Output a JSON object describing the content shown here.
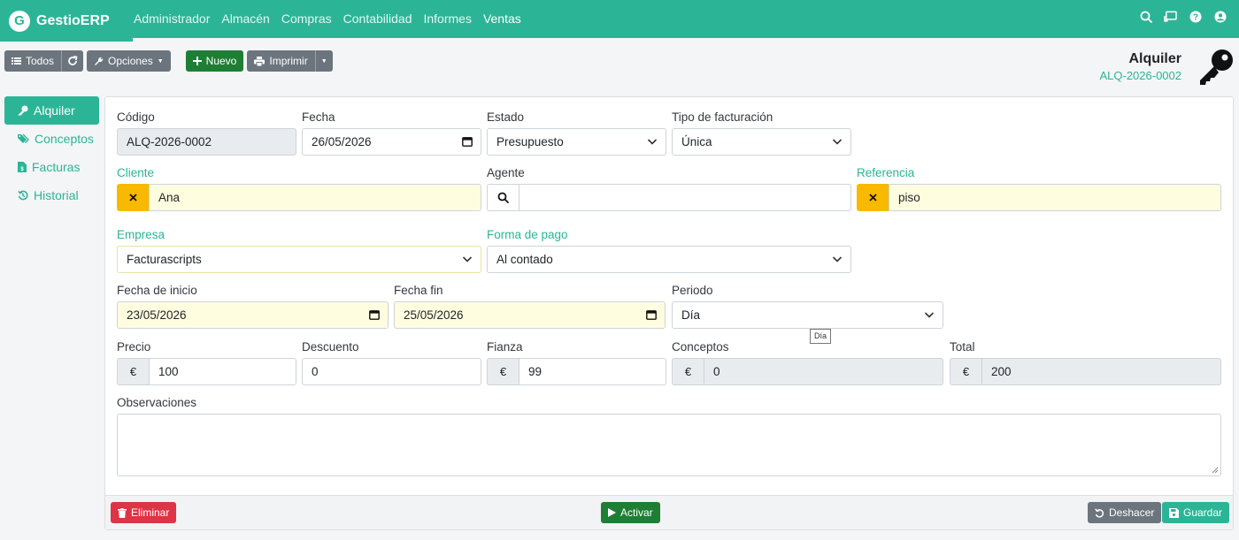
{
  "app": {
    "logo_letter": "G",
    "name": "GestioERP"
  },
  "nav": {
    "menu": [
      "Administrador",
      "Almacén",
      "Compras",
      "Contabilidad",
      "Informes",
      "Ventas"
    ],
    "icons": [
      "search-icon",
      "screen-icon",
      "help-icon",
      "user-icon"
    ]
  },
  "toolbar": {
    "all_label": "Todos",
    "options_label": "Opciones",
    "new_label": "Nuevo",
    "print_label": "Imprimir"
  },
  "page": {
    "title": "Alquiler",
    "code": "ALQ-2026-0002"
  },
  "tabs": [
    "Alquiler",
    "Conceptos",
    "Facturas",
    "Historial"
  ],
  "form": {
    "codigo": {
      "label": "Código",
      "value": "ALQ-2026-0002"
    },
    "fecha": {
      "label": "Fecha",
      "value": "26/05/2026"
    },
    "estado": {
      "label": "Estado",
      "value": "Presupuesto"
    },
    "tipo_facturacion": {
      "label": "Tipo de facturación",
      "value": "Única"
    },
    "cliente": {
      "label": "Cliente",
      "value": "Ana"
    },
    "agente": {
      "label": "Agente",
      "value": ""
    },
    "referencia": {
      "label": "Referencia",
      "value": "piso"
    },
    "empresa": {
      "label": "Empresa",
      "value": "Facturascripts"
    },
    "forma_pago": {
      "label": "Forma de pago",
      "value": "Al contado"
    },
    "fecha_inicio": {
      "label": "Fecha de inicio",
      "value": "23/05/2026"
    },
    "fecha_fin": {
      "label": "Fecha fin",
      "value": "25/05/2026"
    },
    "periodo": {
      "label": "Periodo",
      "value": "Día",
      "tooltip": "Día"
    },
    "precio": {
      "label": "Precio",
      "currency": "€",
      "value": "100"
    },
    "descuento": {
      "label": "Descuento",
      "value": "0"
    },
    "fianza": {
      "label": "Fianza",
      "currency": "€",
      "value": "99"
    },
    "conceptos": {
      "label": "Conceptos",
      "currency": "€",
      "value": "0"
    },
    "total": {
      "label": "Total",
      "currency": "€",
      "value": "200"
    },
    "observaciones": {
      "label": "Observaciones",
      "value": ""
    }
  },
  "actions": {
    "delete_label": "Eliminar",
    "activate_label": "Activar",
    "undo_label": "Deshacer",
    "save_label": "Guardar"
  },
  "colors": {
    "accent": "#2bb596",
    "warning": "#f8b900",
    "danger": "#dc3545",
    "success": "#1e7e34",
    "secondary": "#6c757d"
  }
}
